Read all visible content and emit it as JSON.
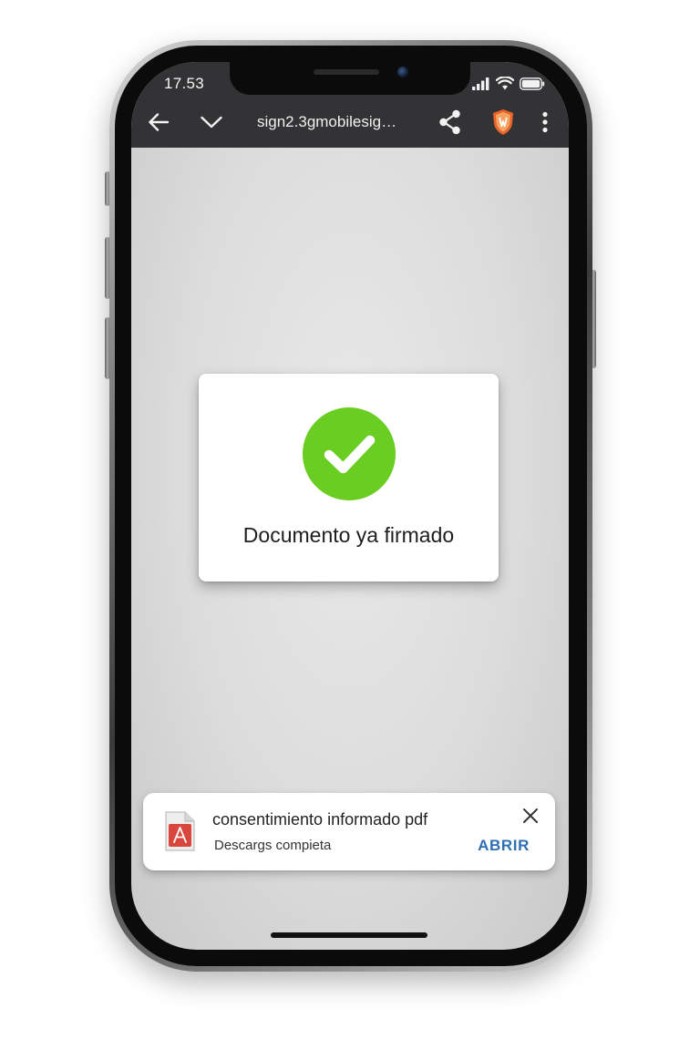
{
  "status_bar": {
    "time": "17.53",
    "icons": [
      "signal-icon",
      "wifi-icon",
      "battery-icon"
    ]
  },
  "browser_toolbar": {
    "back_icon": "arrow-left-icon",
    "collapse_icon": "chevron-down-icon",
    "url": "sign2.3gmobilesig…",
    "share_icon": "share-icon",
    "extension_icon": "shield-extension-icon",
    "menu_icon": "more-vertical-icon"
  },
  "status_card": {
    "icon": "checkmark-icon",
    "message": "Documento ya firmado"
  },
  "download_notice": {
    "file_icon": "pdf-file-icon",
    "file_name": "consentimiento informado pdf",
    "status": "Descargs compieta",
    "action_label": "ABRIR",
    "close_icon": "close-icon"
  },
  "colors": {
    "toolbar_bg": "#333335",
    "success_green": "#6acd21",
    "action_blue": "#2f6fb4",
    "extension_orange": "#e8632b",
    "pdf_red": "#d9463b"
  }
}
